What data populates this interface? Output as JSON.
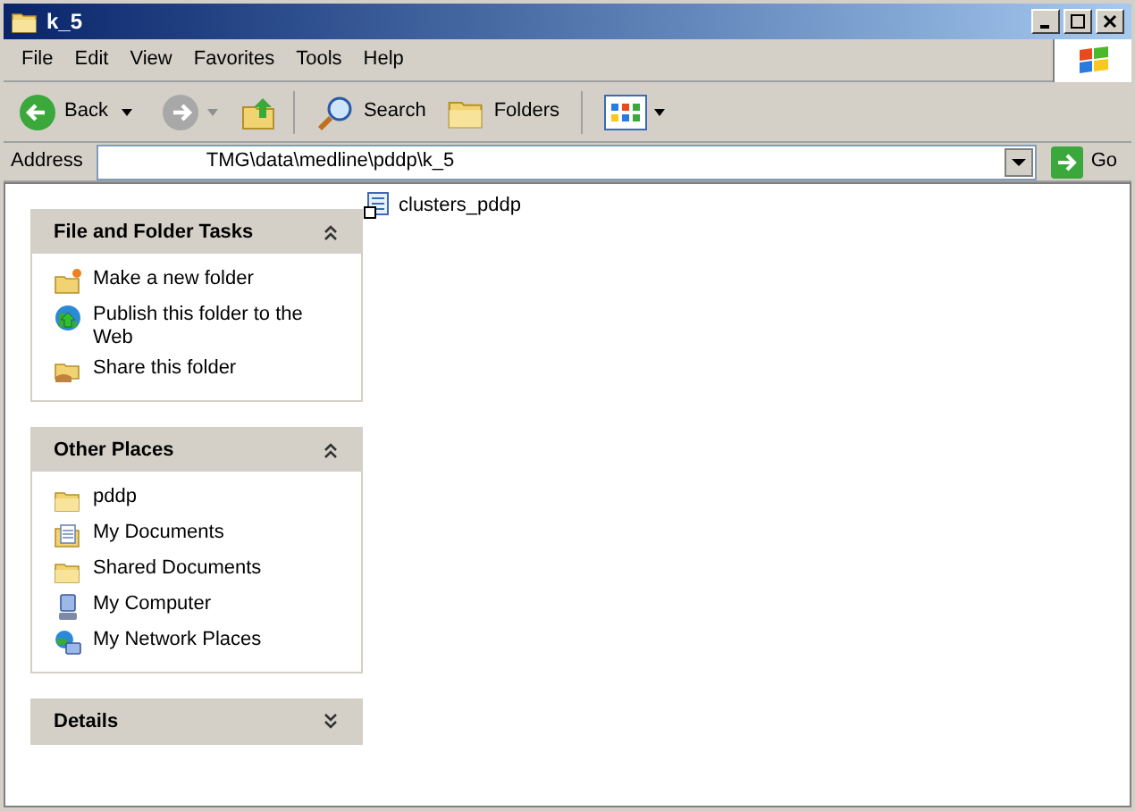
{
  "window": {
    "title": "k_5"
  },
  "menu": [
    "File",
    "Edit",
    "View",
    "Favorites",
    "Tools",
    "Help"
  ],
  "toolbar": {
    "back": "Back",
    "search": "Search",
    "folders": "Folders"
  },
  "address": {
    "label": "Address",
    "value": "TMG\\data\\medline\\pddp\\k_5",
    "go": "Go"
  },
  "panels": [
    {
      "title": "File and Folder Tasks",
      "expanded": true,
      "items": [
        {
          "label": "Make a new folder",
          "kind": "newfolder"
        },
        {
          "label": "Publish this folder to the Web",
          "kind": "globe"
        },
        {
          "label": "Share this folder",
          "kind": "share"
        }
      ]
    },
    {
      "title": "Other Places",
      "expanded": true,
      "items": [
        {
          "label": "pddp",
          "kind": "folder"
        },
        {
          "label": "My Documents",
          "kind": "documents"
        },
        {
          "label": "Shared Documents",
          "kind": "folder"
        },
        {
          "label": "My Computer",
          "kind": "computer"
        },
        {
          "label": "My Network Places",
          "kind": "network"
        }
      ]
    },
    {
      "title": "Details",
      "expanded": false
    }
  ],
  "files": [
    {
      "name": "clusters_pddp"
    }
  ]
}
